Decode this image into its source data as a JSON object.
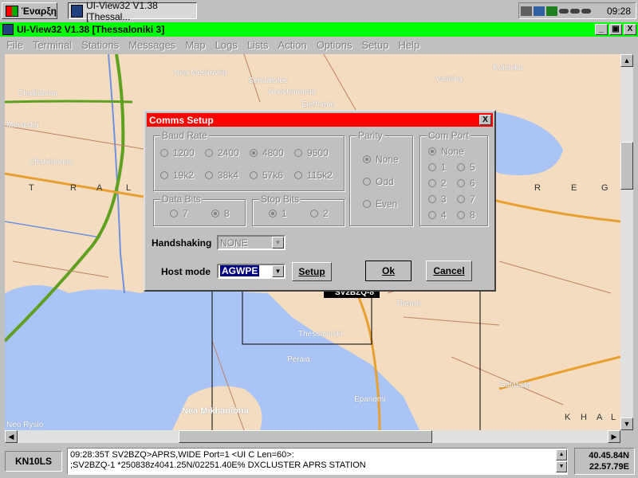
{
  "taskbar": {
    "start_label": "Έναρξη",
    "task_label": "UI-View32 V1.38 [Thessal...",
    "clock": "09:28"
  },
  "window": {
    "title": "UI-View32 V1.38 [Thessaloniki 3]",
    "minimize": "_",
    "restore": "▣",
    "close": "X"
  },
  "menu": [
    "File",
    "Terminal",
    "Stations",
    "Messages",
    "Map",
    "Logs",
    "Lists",
    "Action",
    "Options",
    "Setup",
    "Help"
  ],
  "map": {
    "labels": [
      "Nea Mesimvria",
      "Sendalofos",
      "Neochorouda",
      "Eleftherio",
      "Vasilika",
      "Koichiko",
      "Chalkidona",
      "Monastiri",
      "Chalkidonos",
      "Thessaloniki",
      "Thermi",
      "Peraia",
      "Nea Mikhanióna",
      "Neo Rysio",
      "Galatista",
      "Epanomi"
    ],
    "region_letters": [
      "T",
      "R",
      "A",
      "L",
      "R",
      "E",
      "G",
      "K",
      "H",
      "A",
      "L"
    ],
    "station_label": "SV2BZQ-8"
  },
  "dialog": {
    "title": "Comms Setup",
    "close": "X",
    "baud_rate": {
      "title": "Baud Rate",
      "options": [
        "1200",
        "2400",
        "4800",
        "9600",
        "19k2",
        "38k4",
        "57k6",
        "115k2"
      ],
      "selected": "4800"
    },
    "parity": {
      "title": "Parity",
      "options": [
        "None",
        "Odd",
        "Even"
      ],
      "selected": "None"
    },
    "com_port": {
      "title": "Com Port",
      "options": [
        "None",
        "1",
        "5",
        "2",
        "6",
        "3",
        "7",
        "4",
        "8"
      ],
      "selected": "None"
    },
    "data_bits": {
      "title": "Data Bits",
      "options": [
        "7",
        "8"
      ],
      "selected": "8"
    },
    "stop_bits": {
      "title": "Stop Bits",
      "options": [
        "1",
        "2"
      ],
      "selected": "1"
    },
    "handshaking": {
      "label": "Handshaking",
      "value": "NONE"
    },
    "host_mode": {
      "label": "Host mode",
      "value": "AGWPE"
    },
    "setup_button": "Setup",
    "ok_button": "Ok",
    "cancel_button": "Cancel"
  },
  "status": {
    "locator": "KN10LS",
    "log_lines": [
      "09:28:35T SV2BZQ>APRS,WIDE Port=1 <UI C Len=60>:",
      ";SV2BZQ-1 *250838z4041.25N/02251.40E% DXCLUSTER APRS STATION"
    ],
    "lat": "40.45.84N",
    "lon": "22.57.79E"
  },
  "colors": {
    "titlebar": "#00ff00",
    "dialog_titlebar": "#ff0000",
    "map_land": "#f3dcc0",
    "map_water": "#a9c4f5",
    "road_main": "#e8a030",
    "road_green": "#60a020"
  }
}
